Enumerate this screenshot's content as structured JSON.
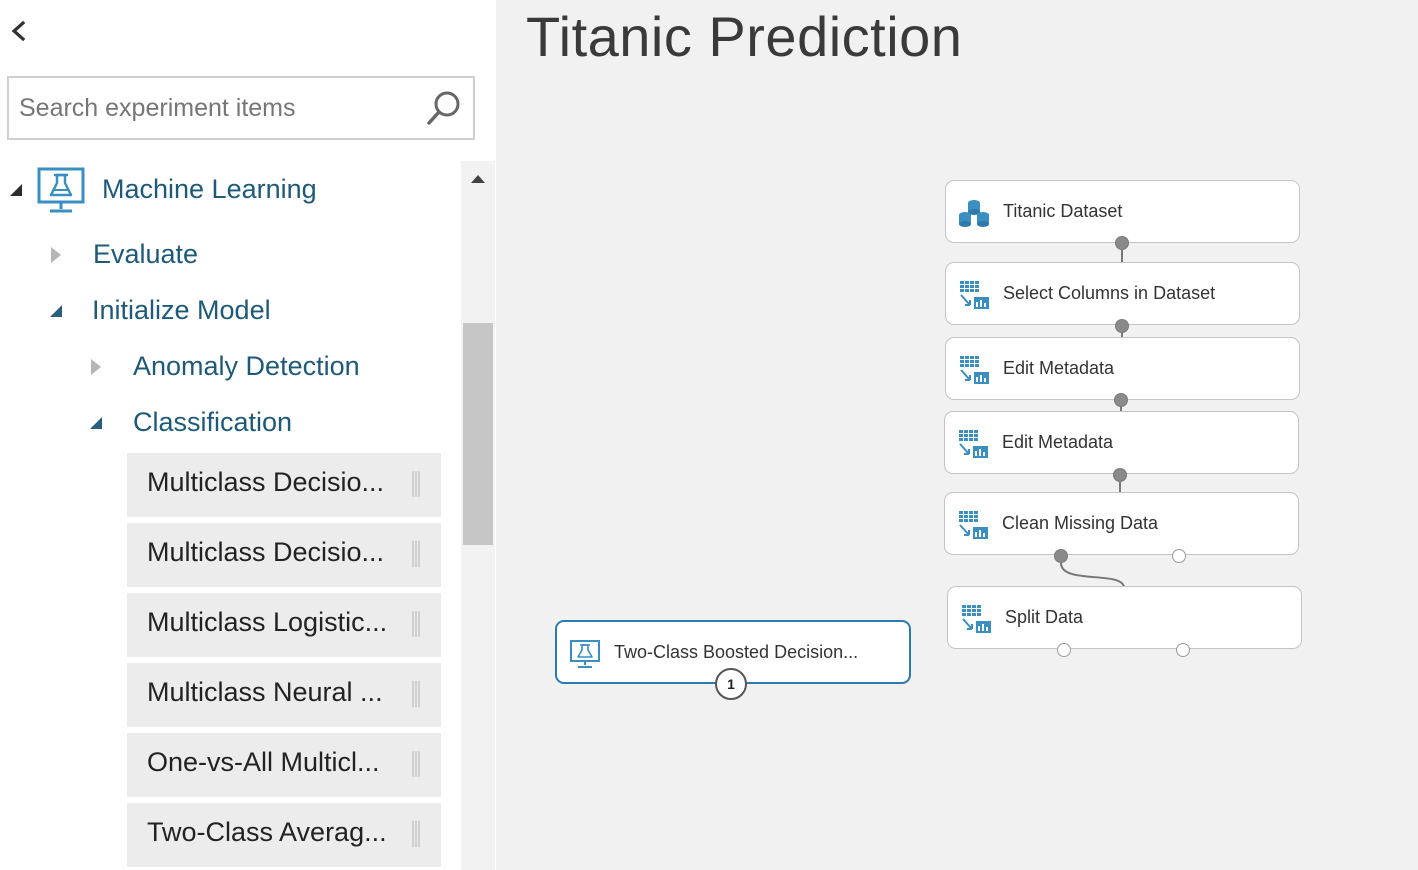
{
  "palette": {
    "search_placeholder": "Search experiment items",
    "tree": {
      "root": {
        "label": "Machine Learning",
        "icon": "flask-monitor-icon",
        "expanded": true
      },
      "evaluate": {
        "label": "Evaluate",
        "expanded": false
      },
      "initialize_model": {
        "label": "Initialize Model",
        "expanded": true
      },
      "anomaly_detection": {
        "label": "Anomaly Detection",
        "expanded": false
      },
      "classification": {
        "label": "Classification",
        "expanded": true
      }
    },
    "modules": [
      "Multiclass Decisio...",
      "Multiclass Decisio...",
      "Multiclass Logistic...",
      "Multiclass Neural ...",
      "One-vs-All Multicl...",
      "Two-Class Averag..."
    ]
  },
  "canvas": {
    "title": "Titanic Prediction",
    "nodes": {
      "titanic_dataset": {
        "label": "Titanic Dataset",
        "icon": "database-icon"
      },
      "select_columns": {
        "label": "Select Columns in Dataset",
        "icon": "table-transform-icon"
      },
      "edit_metadata_1": {
        "label": "Edit Metadata",
        "icon": "table-transform-icon"
      },
      "edit_metadata_2": {
        "label": "Edit Metadata",
        "icon": "table-transform-icon"
      },
      "clean_missing": {
        "label": "Clean Missing Data",
        "icon": "table-transform-icon"
      },
      "split_data": {
        "label": "Split Data",
        "icon": "table-transform-icon"
      },
      "two_class_boosted": {
        "label": "Two-Class Boosted Decision...",
        "icon": "flask-monitor-icon",
        "selected": true,
        "badge": "1"
      }
    }
  },
  "colors": {
    "tree_label": "#1d5a7a",
    "icon_blue": "#3a8fc2",
    "selected_border": "#2b7bb0",
    "canvas_bg": "#f1f1f1",
    "module_bg": "#ececec"
  }
}
